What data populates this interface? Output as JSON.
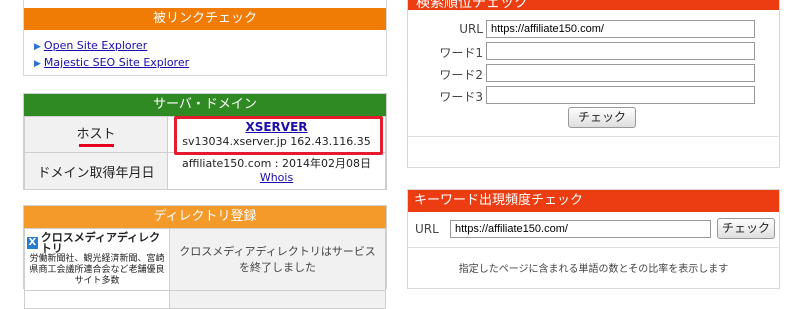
{
  "backlink": {
    "title": "被リンクチェック",
    "links": [
      "Open Site Explorer",
      "Majestic SEO Site Explorer"
    ]
  },
  "server": {
    "title": "サーバ・ドメイン",
    "host_label": "ホスト",
    "host_name": "XSERVER",
    "host_detail": "sv13034.xserver.jp 162.43.116.35",
    "domain_label": "ドメイン取得年月日",
    "domain_value": "affiliate150.com : 2014年02月08日",
    "whois_link": "Whois"
  },
  "directory": {
    "title": "ディレクトリ登録",
    "logo_mark": "X",
    "logo_title": "クロスメディアディレクトリ",
    "logo_sub": "労働新聞社、観光経済新聞、宮崎県商工会議所連合会など老舗優良サイト多数",
    "message": "クロスメディアディレクトリはサービスを終了しました"
  },
  "rank": {
    "title": "検索順位チェック",
    "url_label": "URL",
    "url_value": "https://affiliate150.com/",
    "word_labels": [
      "ワード1",
      "ワード2",
      "ワード3"
    ],
    "word_values": [
      "",
      "",
      ""
    ],
    "check_button": "チェック"
  },
  "keyword": {
    "title": "キーワード出現頻度チェック",
    "url_label": "URL",
    "url_value": "https://affiliate150.com/",
    "check_button": "チェック",
    "note": "指定したページに含まれる単語の数とその比率を表示します"
  },
  "colors": {
    "orange_header": "#f07c05",
    "green_header": "#2f8a23",
    "red_header": "#ec3c12",
    "highlight_box": "#e31b2d"
  }
}
